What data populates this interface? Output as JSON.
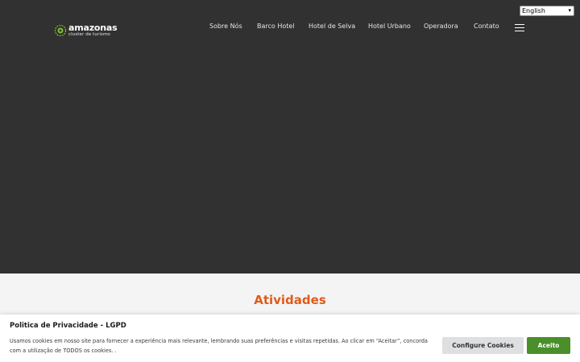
{
  "language_select": {
    "selected": "English"
  },
  "logo": {
    "name": "amazonas",
    "tagline": "cluster de turismo"
  },
  "nav": {
    "items": [
      {
        "label": "Sobre Nós"
      },
      {
        "label": "Barco Hotel"
      },
      {
        "label": "Hotel de Selva"
      },
      {
        "label": "Hotel Urbano"
      },
      {
        "label": "Operadora"
      },
      {
        "label": "Contato"
      }
    ]
  },
  "section": {
    "title": "Atividades"
  },
  "cookie": {
    "title": "Politica de Privacidade - LGPD",
    "text": "Usamos cookies em nosso site para fornecer a experiência mais relevante, lembrando suas preferências e visitas repetidas. Ao clicar em “Aceitar”, concorda com a utilização de TODOS os cookies. .",
    "configure_label": "Configure Cookies",
    "accept_label": "Aceito"
  },
  "colors": {
    "hero_background": "#313131",
    "accent_orange": "#e05b1a",
    "accept_green": "#4a8f2a"
  },
  "icons": {
    "menu": "hamburger-menu-icon",
    "logo_mark": "leaf-cluster-icon",
    "select_caret": "chevron-down-icon"
  }
}
